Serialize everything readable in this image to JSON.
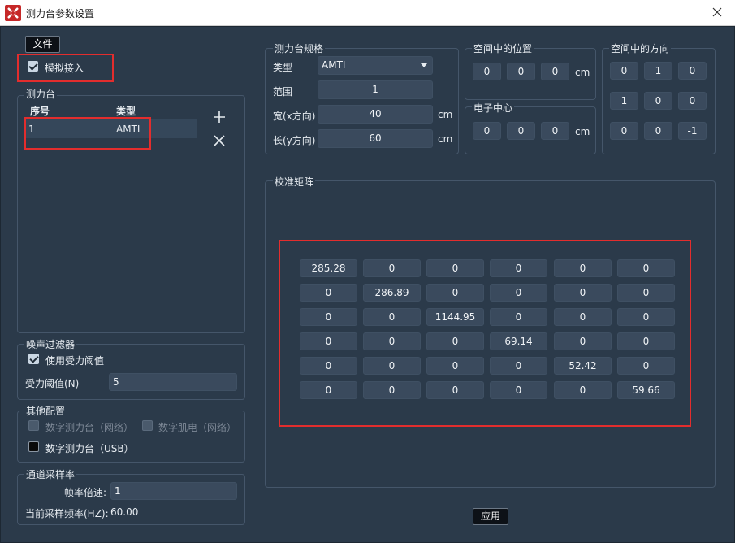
{
  "window": {
    "title": "测力台参数设置",
    "app_icon": "app-logo-icon",
    "close_icon": "close-icon"
  },
  "toolbar": {
    "file_label": "文件"
  },
  "simulate": {
    "label": "模拟接入",
    "checked": true
  },
  "plates_group": {
    "title": "测力台",
    "columns": [
      "序号",
      "类型"
    ],
    "rows": [
      {
        "index": "1",
        "type": "AMTI"
      }
    ],
    "add_icon": "plus-icon",
    "remove_icon": "close-icon"
  },
  "noise_filter": {
    "title": "噪声过滤器",
    "use_threshold_label": "使用受力阈值",
    "use_threshold_checked": true,
    "threshold_label": "受力阈值(N)",
    "threshold_value": "5"
  },
  "other_config": {
    "title": "其他配置",
    "digital_network_label": "数字测力台（网络）",
    "digital_emg_label": "数字肌电（网络）",
    "digital_usb_label": "数字测力台（USB）"
  },
  "sampling": {
    "title": "通道采样率",
    "rate_multiplier_label": "帧率倍速:",
    "rate_multiplier_value": "1",
    "current_rate_label": "当前采样频率(HZ):",
    "current_rate_value": "60.00"
  },
  "spec": {
    "title": "测力台规格",
    "type_label": "类型",
    "type_value": "AMTI",
    "range_label": "范围",
    "range_value": "1",
    "width_label": "宽(x方向)",
    "width_value": "40",
    "width_unit": "cm",
    "length_label": "长(y方向)",
    "length_value": "60",
    "length_unit": "cm"
  },
  "position": {
    "title": "空间中的位置",
    "values": [
      "0",
      "0",
      "0"
    ],
    "unit": "cm"
  },
  "center": {
    "title": "电子中心",
    "values": [
      "0",
      "0",
      "0"
    ],
    "unit": "cm"
  },
  "orientation": {
    "title": "空间中的方向",
    "values": [
      [
        "0",
        "1",
        "0"
      ],
      [
        "1",
        "0",
        "0"
      ],
      [
        "0",
        "0",
        "-1"
      ]
    ]
  },
  "calibration": {
    "title": "校准矩阵",
    "matrix": [
      [
        "285.28",
        "0",
        "0",
        "0",
        "0",
        "0"
      ],
      [
        "0",
        "286.89",
        "0",
        "0",
        "0",
        "0"
      ],
      [
        "0",
        "0",
        "1144.95",
        "0",
        "0",
        "0"
      ],
      [
        "0",
        "0",
        "0",
        "69.14",
        "0",
        "0"
      ],
      [
        "0",
        "0",
        "0",
        "0",
        "52.42",
        "0"
      ],
      [
        "0",
        "0",
        "0",
        "0",
        "0",
        "59.66"
      ]
    ]
  },
  "apply_label": "应用"
}
